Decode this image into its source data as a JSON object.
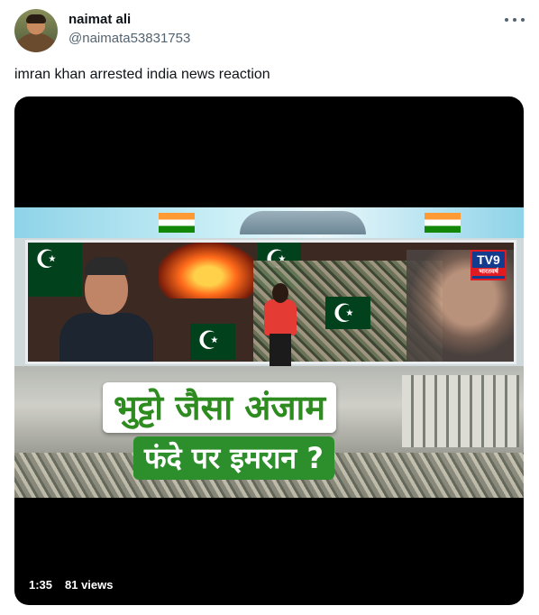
{
  "author": {
    "name": "naimat ali",
    "handle": "@naimata53831753"
  },
  "tweet": {
    "text": "imran khan arrested india news reaction"
  },
  "video": {
    "channel_logo": "TV9",
    "channel_sub": "भारतवर्ष",
    "caption_line1": "भुट्टो जैसा अंजाम",
    "caption_line2": "फंदे पर इमरान ?",
    "duration": "1:35",
    "views": "81 views"
  },
  "icons": {
    "more": "more-horizontal-icon"
  },
  "colors": {
    "caption_green": "#2d8f2b",
    "text_primary": "#0f1419",
    "text_secondary": "#536471"
  }
}
